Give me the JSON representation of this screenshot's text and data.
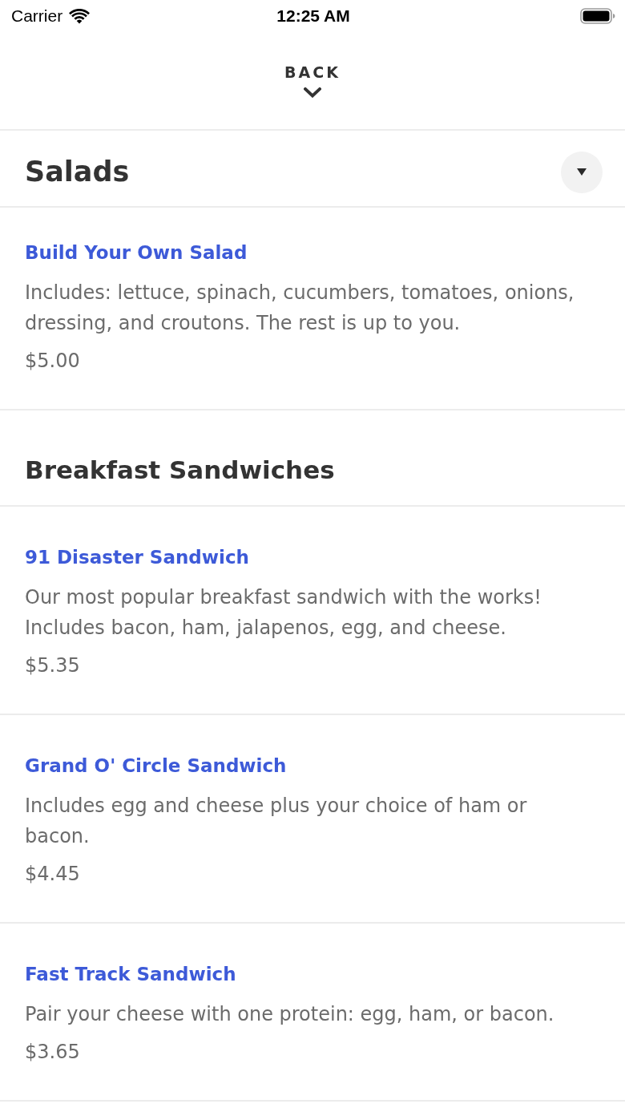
{
  "status_bar": {
    "carrier": "Carrier",
    "time": "12:25 AM"
  },
  "header": {
    "back_label": "BACK"
  },
  "sections": [
    {
      "title": "Salads",
      "kind": "dropdown",
      "items": [
        {
          "name": "Build Your Own Salad",
          "description": "Includes: lettuce, spinach, cucumbers, tomatoes, onions, dressing, and croutons. The rest is up to you.",
          "price": "$5.00"
        }
      ]
    },
    {
      "title": "Breakfast Sandwiches",
      "kind": "plain",
      "items": [
        {
          "name": "91 Disaster Sandwich",
          "description": "Our most popular breakfast sandwich with the works! Includes bacon, ham, jalapenos, egg, and cheese.",
          "price": "$5.35"
        },
        {
          "name": "Grand O' Circle Sandwich",
          "description": "Includes egg and cheese plus your choice of ham or bacon.",
          "price": "$4.45"
        },
        {
          "name": "Fast Track Sandwich",
          "description": "Pair your cheese with one protein: egg, ham, or bacon.",
          "price": "$3.65"
        }
      ]
    }
  ]
}
